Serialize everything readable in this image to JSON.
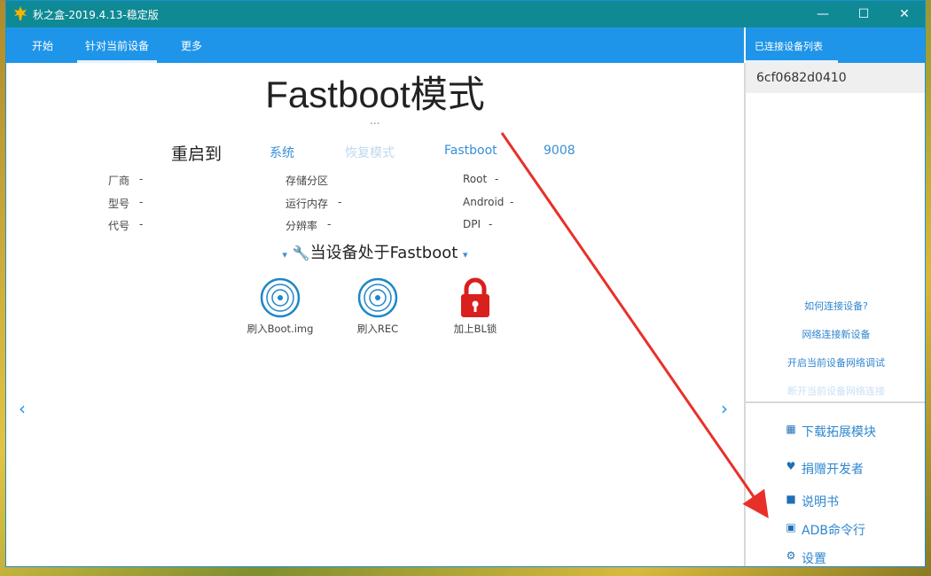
{
  "window": {
    "title": "秋之盒-2019.4.13-稳定版",
    "app_icon": "maple-leaf-icon",
    "controls": {
      "minimize": "—",
      "maximize": "☐",
      "close": "✕"
    }
  },
  "menu": {
    "items": [
      "开始",
      "针对当前设备",
      "更多"
    ],
    "active_index": 1
  },
  "right_panel": {
    "header": "已连接设备列表",
    "devices": [
      "6cf0682d0410"
    ],
    "links": [
      "如何连接设备?",
      "网络连接新设备",
      "开启当前设备网络调试",
      "断开当前设备网络连接"
    ],
    "actions": [
      {
        "label": "下载拓展模块",
        "icon": "grid-icon"
      },
      {
        "label": "捐赠开发者",
        "icon": "heart-icon"
      },
      {
        "label": "说明书",
        "icon": "book-icon"
      },
      {
        "label": "ADB命令行",
        "icon": "terminal-icon"
      },
      {
        "label": "设置",
        "icon": "gear-icon"
      }
    ]
  },
  "main": {
    "title": "Fastboot模式",
    "subtitle": "...",
    "reboot": {
      "label": "重启到",
      "options": [
        "系统",
        "恢复模式",
        "Fastboot",
        "9008"
      ]
    },
    "info": {
      "col1": [
        [
          "厂商",
          "-"
        ],
        [
          "型号",
          "-"
        ],
        [
          "代号",
          "-"
        ]
      ],
      "col2": [
        [
          "存储分区",
          ""
        ],
        [
          "运行内存",
          "-"
        ],
        [
          "分辨率",
          "-"
        ]
      ],
      "col3": [
        [
          "Root",
          "-"
        ],
        [
          "Android",
          "-"
        ],
        [
          "DPI",
          "-"
        ]
      ]
    },
    "state": "当设备处于Fastboot",
    "tiles": [
      {
        "label": "刷入Boot.img",
        "icon": "disc-icon"
      },
      {
        "label": "刷入REC",
        "icon": "disc-icon"
      },
      {
        "label": "加上BL锁",
        "icon": "lock-icon"
      }
    ],
    "nav": {
      "prev": "‹",
      "next": "›"
    }
  },
  "colors": {
    "titlebar": "#0f8a94",
    "menubar": "#1f95e9",
    "link": "#2f86cf",
    "annotation_arrow": "#e8302a"
  }
}
